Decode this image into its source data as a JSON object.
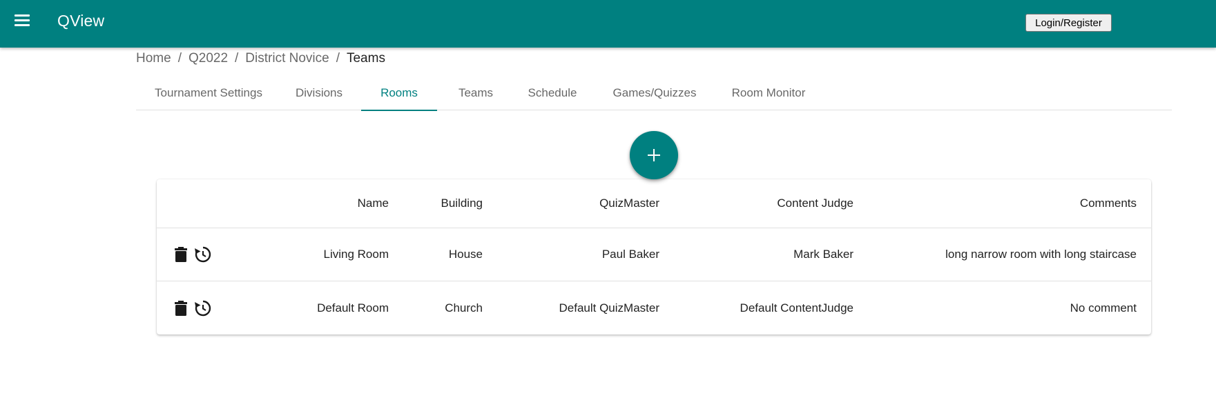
{
  "app": {
    "title": "QView",
    "login_label": "Login/Register"
  },
  "breadcrumb": [
    "Home",
    "Q2022",
    "District Novice",
    "Teams"
  ],
  "tabs": [
    {
      "label": "Tournament Settings",
      "active": false
    },
    {
      "label": "Divisions",
      "active": false
    },
    {
      "label": "Rooms",
      "active": true
    },
    {
      "label": "Teams",
      "active": false
    },
    {
      "label": "Schedule",
      "active": false
    },
    {
      "label": "Games/Quizzes",
      "active": false
    },
    {
      "label": "Room Monitor",
      "active": false
    }
  ],
  "fab": {
    "icon": "plus-icon"
  },
  "table": {
    "headers": {
      "name": "Name",
      "building": "Building",
      "quizmaster": "QuizMaster",
      "content_judge": "Content Judge",
      "comments": "Comments"
    },
    "rows": [
      {
        "name": "Living Room",
        "building": "House",
        "quizmaster": "Paul Baker",
        "content_judge": "Mark Baker",
        "comments": "long narrow room with long staircase",
        "actions": [
          "delete-icon",
          "reset-icon"
        ]
      },
      {
        "name": "Default Room",
        "building": "Church",
        "quizmaster": "Default QuizMaster",
        "content_judge": "Default ContentJudge",
        "comments": "No comment",
        "actions": [
          "delete-icon",
          "reset-icon"
        ]
      }
    ]
  },
  "colors": {
    "primary": "#008080",
    "tab_inactive": "#666666",
    "text": "#212121"
  }
}
